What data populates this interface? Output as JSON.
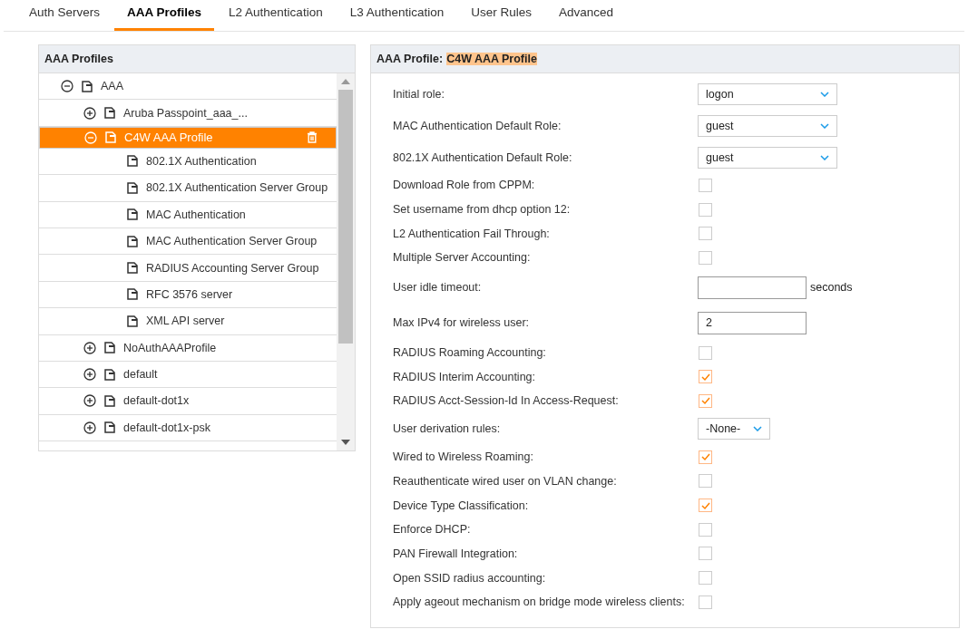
{
  "tabs": [
    {
      "label": "Auth Servers",
      "selected": false
    },
    {
      "label": "AAA Profiles",
      "selected": true
    },
    {
      "label": "L2 Authentication",
      "selected": false
    },
    {
      "label": "L3 Authentication",
      "selected": false
    },
    {
      "label": "User Rules",
      "selected": false
    },
    {
      "label": "Advanced",
      "selected": false
    }
  ],
  "tree_panel": {
    "title": "AAA Profiles",
    "nodes": [
      {
        "label": "AAA",
        "expanded": true,
        "selected": false,
        "children": [
          {
            "label": "Aruba Passpoint_aaa_...",
            "expanded": false,
            "selected": false
          },
          {
            "label": "C4W AAA Profile",
            "expanded": true,
            "selected": true,
            "children": [
              {
                "label": "802.1X Authentication",
                "selected": false
              },
              {
                "label": "802.1X Authentication Server Group",
                "selected": false
              },
              {
                "label": "MAC Authentication",
                "selected": false
              },
              {
                "label": "MAC Authentication Server Group",
                "selected": false
              },
              {
                "label": "RADIUS Accounting Server Group",
                "selected": false
              },
              {
                "label": "RFC 3576 server",
                "selected": false
              },
              {
                "label": "XML API server",
                "selected": false
              }
            ]
          },
          {
            "label": "NoAuthAAAProfile",
            "expanded": false,
            "selected": false
          },
          {
            "label": "default",
            "expanded": false,
            "selected": false
          },
          {
            "label": "default-dot1x",
            "expanded": false,
            "selected": false
          },
          {
            "label": "default-dot1x-psk",
            "expanded": false,
            "selected": false
          }
        ]
      }
    ]
  },
  "form_panel": {
    "title": "AAA Profile:",
    "profile_name": "C4W AAA Profile",
    "fields": [
      {
        "kind": "select",
        "label": "Initial role:",
        "value": "logon"
      },
      {
        "kind": "select",
        "label": "MAC Authentication Default Role:",
        "value": "guest"
      },
      {
        "kind": "select",
        "label": "802.1X Authentication Default Role:",
        "value": "guest"
      },
      {
        "kind": "checkbox",
        "label": "Download Role from CPPM:",
        "checked": false
      },
      {
        "kind": "checkbox",
        "label": "Set username from dhcp option 12:",
        "checked": false
      },
      {
        "kind": "checkbox",
        "label": "L2 Authentication Fail Through:",
        "checked": false
      },
      {
        "kind": "checkbox",
        "label": "Multiple Server Accounting:",
        "checked": false
      },
      {
        "kind": "text",
        "label": "User idle timeout:",
        "suffix": "seconds"
      },
      {
        "kind": "text",
        "label": "Max IPv4 for wireless user:",
        "value": "2"
      },
      {
        "kind": "checkbox",
        "label": "RADIUS Roaming Accounting:",
        "checked": false
      },
      {
        "kind": "checkbox",
        "label": "RADIUS Interim Accounting:",
        "checked": true
      },
      {
        "kind": "checkbox",
        "label": "RADIUS Acct-Session-Id In Access-Request:",
        "checked": true
      },
      {
        "kind": "smallselect",
        "label": "User derivation rules:",
        "value": "-None-"
      },
      {
        "kind": "checkbox",
        "label": "Wired to Wireless Roaming:",
        "checked": true
      },
      {
        "kind": "checkbox",
        "label": "Reauthenticate wired user on VLAN change:",
        "checked": false
      },
      {
        "kind": "checkbox",
        "label": "Device Type Classification:",
        "checked": true
      },
      {
        "kind": "checkbox",
        "label": "Enforce DHCP:",
        "checked": false
      },
      {
        "kind": "checkbox",
        "label": "PAN Firewall Integration:",
        "checked": false
      },
      {
        "kind": "checkbox",
        "label": "Open SSID radius accounting:",
        "checked": false
      },
      {
        "kind": "checkbox",
        "label": "Apply ageout mechanism on bridge mode wireless clients:",
        "checked": false
      }
    ]
  }
}
